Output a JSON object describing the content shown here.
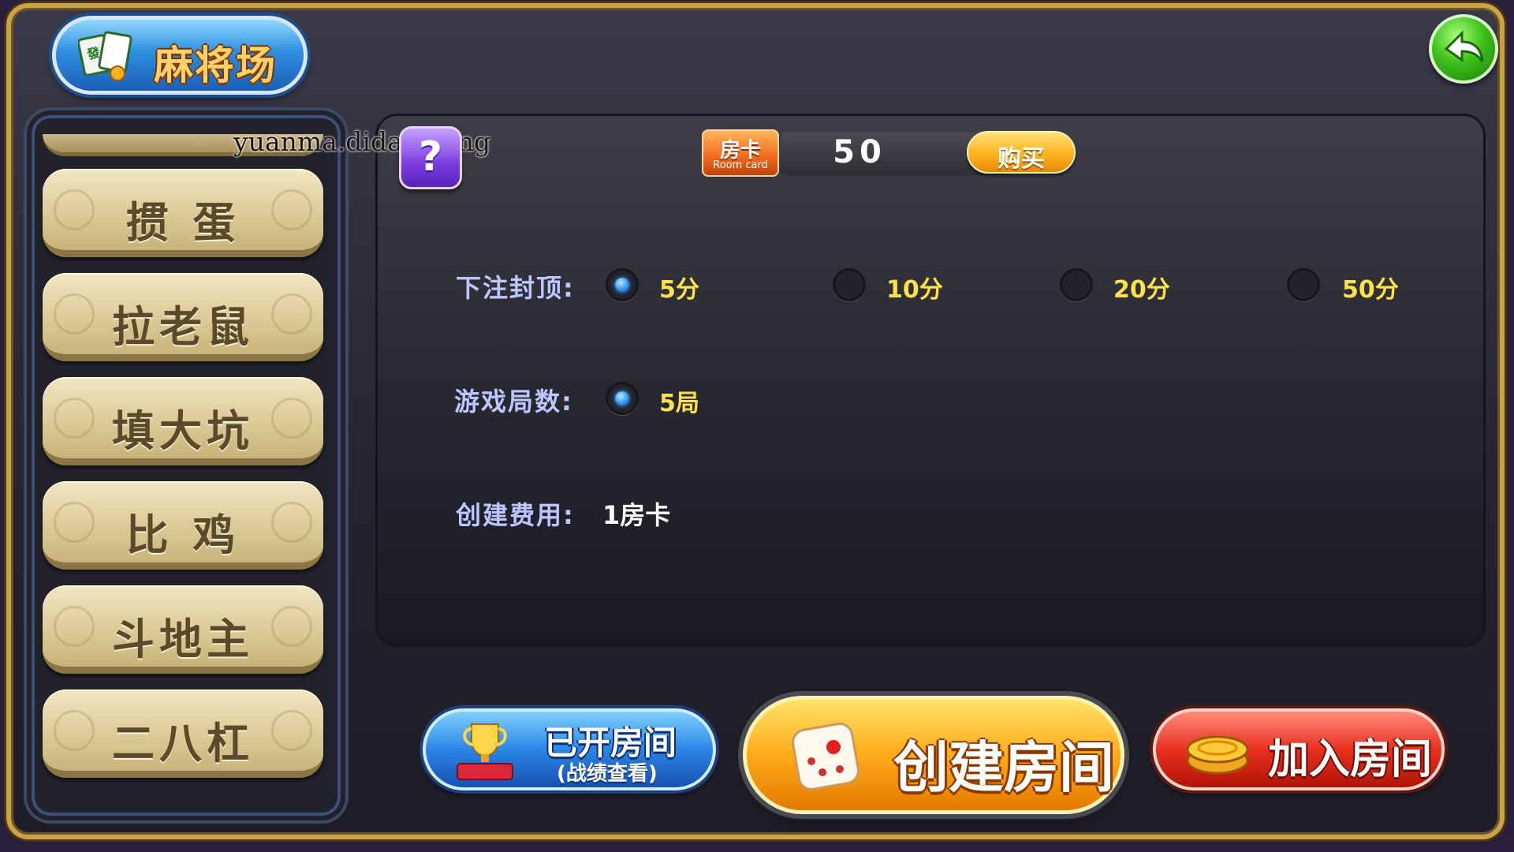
{
  "header": {
    "title": "麻将场",
    "back_icon": "back-arrow-icon"
  },
  "sidebar": {
    "items": [
      {
        "label": "掼 蛋"
      },
      {
        "label": "拉老鼠"
      },
      {
        "label": "填大坑"
      },
      {
        "label": "比 鸡"
      },
      {
        "label": "斗地主"
      },
      {
        "label": "二八杠"
      }
    ]
  },
  "watermark": "yuanma.didai.wang",
  "help": {
    "symbol": "?"
  },
  "room_card": {
    "label": "房卡",
    "label_en": "Room card",
    "count": "50",
    "buy_label": "购买"
  },
  "settings": {
    "bet_cap": {
      "label": "下注封顶:",
      "options": [
        "5分",
        "10分",
        "20分",
        "50分"
      ],
      "selected": "5分"
    },
    "rounds": {
      "label": "游戏局数:",
      "options": [
        "5局"
      ],
      "selected": "5局"
    },
    "fee": {
      "label": "创建费用:",
      "value": "1房卡"
    }
  },
  "actions": {
    "opened_rooms": {
      "label": "已开房间",
      "sub": "(战绩查看)"
    },
    "create_room": {
      "label": "创建房间"
    },
    "join_room": {
      "label": "加入房间"
    }
  },
  "colors": {
    "accent_gold": "#ffe14a",
    "label_blue": "#bcc6ff",
    "panel_bg": "#2a2a33",
    "frame_gold": "#c9a24a"
  }
}
